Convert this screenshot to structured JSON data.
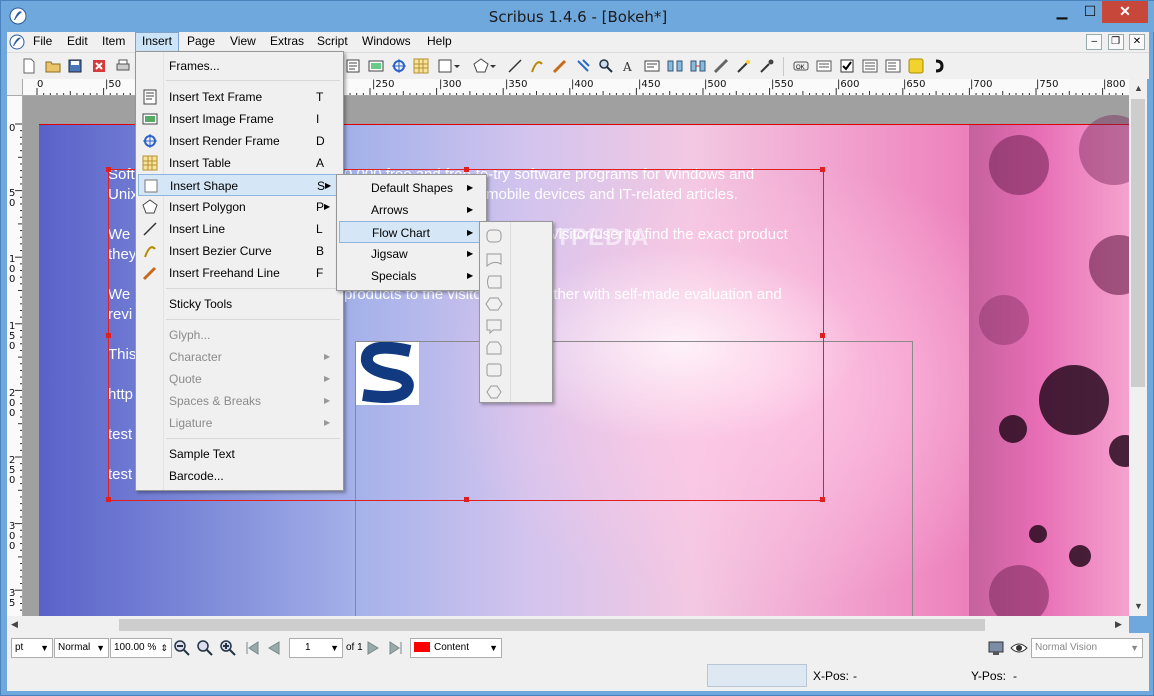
{
  "window": {
    "title": "Scribus 1.4.6 - [Bokeh*]",
    "minimize": "▁",
    "maximize": "☐",
    "close": "✕"
  },
  "menubar": {
    "items": [
      "File",
      "Edit",
      "Item",
      "Insert",
      "Page",
      "View",
      "Extras",
      "Script",
      "Windows",
      "Help"
    ],
    "active": "Insert",
    "mdi": [
      "–",
      "❐",
      "✕"
    ]
  },
  "ruler": {
    "top_labels": [
      "0",
      "|50",
      "|250",
      "|300",
      "|350",
      "|400",
      "|450",
      "|500",
      "|550",
      "|600",
      "|650",
      "|700",
      "|750",
      "|800"
    ],
    "left_labels": [
      "0",
      "5",
      "0",
      "1",
      "0",
      "0",
      "1",
      "5",
      "0",
      "2",
      "0",
      "0",
      "2",
      "5",
      "0",
      "3",
      "0",
      "0",
      "3",
      "5"
    ]
  },
  "page": {
    "lines": [
      "Soft",
      "Unix",
      "We",
      "they",
      "We",
      "revi",
      "This",
      "http",
      "test",
      "test"
    ],
    "right_fragments": [
      "0,000 free and free-to-try software programs for Windows and",
      "mobile devices and IT-related articles.",
      "visitor/user to find the exact product",
      "products to the visitor/user together with self-made evaluation and"
    ],
    "watermark": "SOFTPEDIA"
  },
  "insert_menu": {
    "items": [
      {
        "label": "Frames...",
        "shortcut": "",
        "icon": "frames-icon",
        "disabled": false
      },
      {
        "label": "Insert Text Frame",
        "shortcut": "T",
        "icon": "text-frame-icon",
        "disabled": false
      },
      {
        "label": "Insert Image Frame",
        "shortcut": "I",
        "icon": "image-frame-icon",
        "disabled": false
      },
      {
        "label": "Insert Render Frame",
        "shortcut": "D",
        "icon": "render-frame-icon",
        "disabled": false
      },
      {
        "label": "Insert Table",
        "shortcut": "A",
        "icon": "table-icon",
        "disabled": false
      },
      {
        "label": "Insert Shape",
        "shortcut": "S",
        "icon": "shape-icon",
        "disabled": false
      },
      {
        "label": "Insert Polygon",
        "shortcut": "P",
        "icon": "polygon-icon",
        "disabled": false
      },
      {
        "label": "Insert Line",
        "shortcut": "L",
        "icon": "line-icon",
        "disabled": false
      },
      {
        "label": "Insert Bezier Curve",
        "shortcut": "B",
        "icon": "bezier-icon",
        "disabled": false
      },
      {
        "label": "Insert Freehand Line",
        "shortcut": "F",
        "icon": "freehand-icon",
        "disabled": false
      },
      {
        "label": "Sticky Tools",
        "shortcut": "",
        "icon": "",
        "disabled": false
      },
      {
        "label": "Glyph...",
        "shortcut": "",
        "icon": "",
        "disabled": true
      },
      {
        "label": "Character",
        "shortcut": "",
        "icon": "",
        "disabled": true
      },
      {
        "label": "Quote",
        "shortcut": "",
        "icon": "",
        "disabled": true
      },
      {
        "label": "Spaces & Breaks",
        "shortcut": "",
        "icon": "",
        "disabled": true
      },
      {
        "label": "Ligature",
        "shortcut": "",
        "icon": "",
        "disabled": true
      },
      {
        "label": "Sample Text",
        "shortcut": "",
        "icon": "",
        "disabled": false
      },
      {
        "label": "Barcode...",
        "shortcut": "",
        "icon": "",
        "disabled": false
      }
    ]
  },
  "shape_submenu": {
    "items": [
      "Default Shapes",
      "Arrows",
      "Flow Chart",
      "Jigsaw",
      "Specials"
    ]
  },
  "statusbar": {
    "unit": "pt",
    "mode": "Normal",
    "zoom": "100.00 %",
    "page_number": "1",
    "page_of": "of 1",
    "layer": "Content",
    "vision": "Normal Vision",
    "xpos_label": "X-Pos:",
    "xpos_value": "-",
    "ypos_label": "Y-Pos:",
    "ypos_value": "-"
  },
  "colors": {
    "accent_red": "#e02020",
    "menu_highlight": "#d5e6f6",
    "window_blue": "#6fa8dc",
    "layer_red": "#ff0000"
  }
}
